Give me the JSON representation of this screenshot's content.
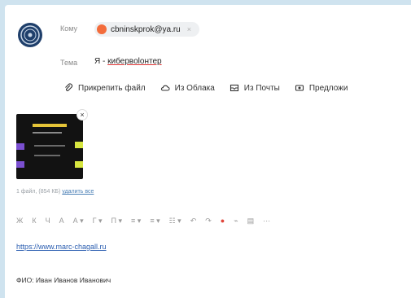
{
  "header": {
    "to_label": "Кому",
    "recipient": "cbninskprok@ya.ru",
    "subject_label": "Тема",
    "subject_prefix": "Я - ",
    "subject_word": "кибервolонтер"
  },
  "attach_bar": {
    "attach_file": "Прикрепить файл",
    "from_cloud": "Из Облака",
    "from_mail": "Из Почты",
    "suggest": "Предложи"
  },
  "attachment": {
    "info_text": "1 файл, (854 КБ)",
    "delete_all": "удалить все"
  },
  "toolbar": {
    "buttons": [
      "Ж",
      "К",
      "Ч",
      "А",
      "А ▾",
      "Г ▾",
      "Π ▾",
      "≡ ▾",
      "≡ ▾",
      "☷ ▾",
      "↶",
      "↷",
      "●",
      "⌁",
      "▤",
      "⋯"
    ]
  },
  "body": {
    "link": "https://www.marc-chagall.ru",
    "fio": "ФИО: Иван Иванов Иванович"
  },
  "colors": {
    "page_bg": "#cfe3ef",
    "chip_dot": "#f36c3b",
    "link": "#2a5db0"
  }
}
